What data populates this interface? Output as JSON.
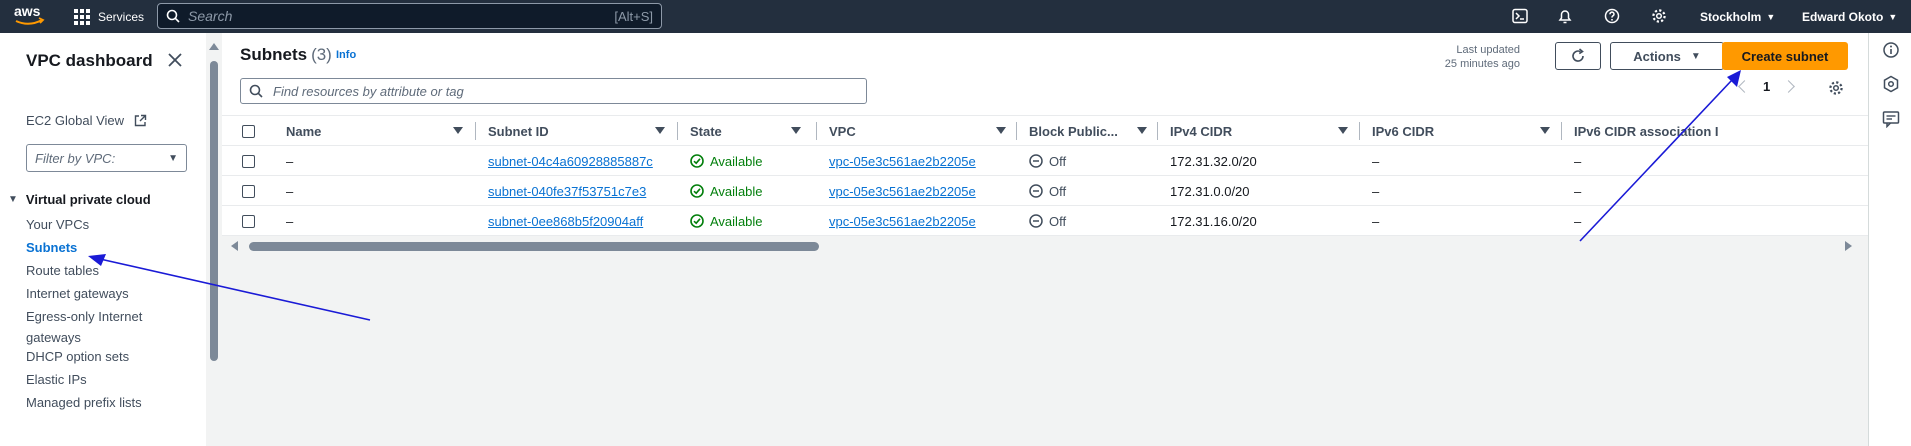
{
  "topnav": {
    "logo_text": "aws",
    "services_label": "Services",
    "search_placeholder": "Search",
    "search_shortcut": "[Alt+S]",
    "region": "Stockholm",
    "user": "Edward Okoto"
  },
  "sidebar": {
    "title": "VPC dashboard",
    "ec2_global_view": "EC2 Global View",
    "filter_placeholder": "Filter by VPC:",
    "section": "Virtual private cloud",
    "items": [
      {
        "label": "Your VPCs"
      },
      {
        "label": "Subnets",
        "active": true
      },
      {
        "label": "Route tables"
      },
      {
        "label": "Internet gateways"
      },
      {
        "label": "Egress-only Internet gateways"
      },
      {
        "label": "DHCP option sets"
      },
      {
        "label": "Elastic IPs"
      },
      {
        "label": "Managed prefix lists"
      }
    ]
  },
  "main": {
    "title": "Subnets",
    "count": "(3)",
    "info": "Info",
    "last_updated_line1": "Last updated",
    "last_updated_line2": "25 minutes ago",
    "actions_label": "Actions",
    "create_label": "Create subnet",
    "find_placeholder": "Find resources by attribute or tag",
    "page_number": "1",
    "columns": [
      "Name",
      "Subnet ID",
      "State",
      "VPC",
      "Block Public...",
      "IPv4 CIDR",
      "IPv6 CIDR",
      "IPv6 CIDR association I"
    ],
    "rows": [
      {
        "name": "–",
        "subnet_id": "subnet-04c4a60928885887c",
        "state": "Available",
        "vpc": "vpc-05e3c561ae2b2205e",
        "block": "Off",
        "ipv4": "172.31.32.0/20",
        "ipv6": "–",
        "ipv6_assoc": "–"
      },
      {
        "name": "–",
        "subnet_id": "subnet-040fe37f53751c7e3",
        "state": "Available",
        "vpc": "vpc-05e3c561ae2b2205e",
        "block": "Off",
        "ipv4": "172.31.0.0/20",
        "ipv6": "–",
        "ipv6_assoc": "–"
      },
      {
        "name": "–",
        "subnet_id": "subnet-0ee868b5f20904aff",
        "state": "Available",
        "vpc": "vpc-05e3c561ae2b2205e",
        "block": "Off",
        "ipv4": "172.31.16.0/20",
        "ipv6": "–",
        "ipv6_assoc": "–"
      }
    ]
  },
  "colors": {
    "topnav_bg": "#232f3e",
    "link": "#0972d3",
    "primary_button": "#ff9900",
    "available": "#037f0c",
    "annotation_arrow": "#1a1ad6"
  }
}
